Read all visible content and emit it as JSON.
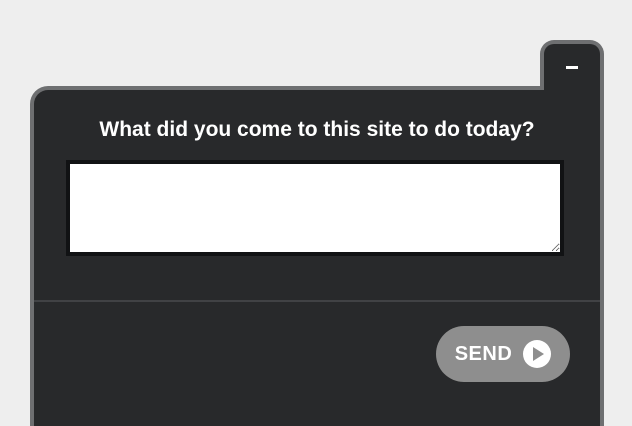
{
  "widget": {
    "question": "What did you come to this site to do today?",
    "answer_value": "",
    "send_label": "SEND",
    "minimize_icon": "minus-icon",
    "send_icon": "play-circle-icon"
  },
  "colors": {
    "page_background": "#eeeeee",
    "panel_background": "#28292b",
    "panel_border": "#6e6f71",
    "send_button_background": "#8e8e8e",
    "text": "#ffffff"
  }
}
